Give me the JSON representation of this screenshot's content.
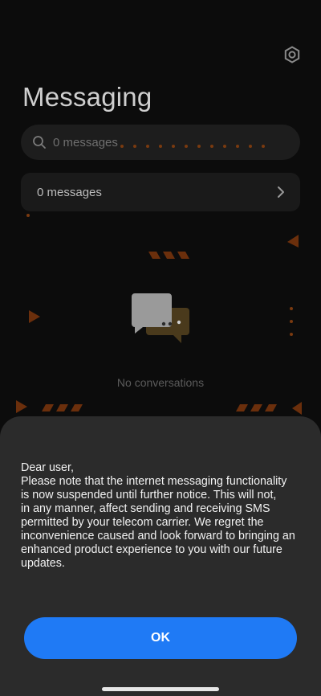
{
  "app": {
    "title": "Messaging"
  },
  "header": {
    "settings_icon": "gear-icon"
  },
  "search": {
    "placeholder": "0 messages",
    "icon": "search-icon"
  },
  "thread_card": {
    "label": "0 messages",
    "icon": "chevron-right-icon"
  },
  "empty_state": {
    "text": "No conversations",
    "icon": "conversation-bubbles-icon"
  },
  "dialog": {
    "lines": [
      "Dear user,",
      "Please note that the internet messaging functionality",
      "is now suspended until further notice. This will not,",
      "in any manner, affect sending and receiving SMS",
      "permitted by your telecom carrier. We regret the",
      "inconvenience caused and look forward to bringing an",
      "enhanced product experience to you with our future",
      "updates."
    ],
    "ok_label": "OK"
  },
  "colors": {
    "accent": "#1f7af5",
    "background": "#0c0c0c",
    "card": "#1a1a1a",
    "dialog": "#2b2b2b",
    "decoration": "#7a3a10"
  }
}
